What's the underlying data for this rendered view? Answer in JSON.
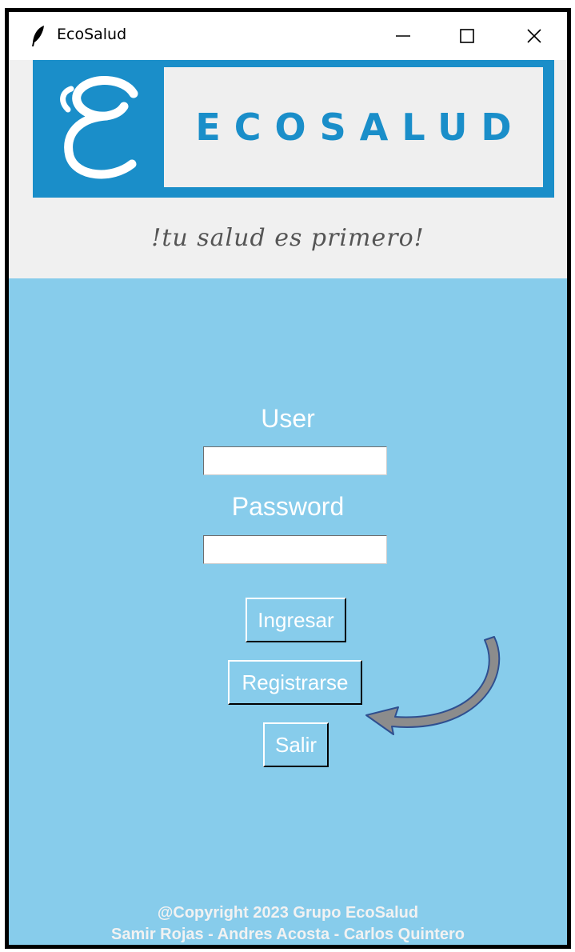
{
  "window": {
    "title": "EcoSalud",
    "controls": [
      "minimize",
      "maximize",
      "close"
    ]
  },
  "header": {
    "logo_text": "ECOSALUD",
    "slogan": "!tu salud es primero!",
    "brand_color": "#1a8ec9"
  },
  "form": {
    "user_label": "User",
    "user_value": "",
    "password_label": "Password",
    "password_value": ""
  },
  "buttons": {
    "login": "Ingresar",
    "register": "Registrarse",
    "exit": "Salir"
  },
  "annotation": {
    "arrow_icon": "curved-arrow-icon",
    "arrow_color": "#8c8c8c"
  },
  "footer": {
    "copyright": "@Copyright 2023 Grupo EcoSalud",
    "authors": "Samir Rojas - Andres Acosta - Carlos Quintero"
  },
  "colors": {
    "background": "#87cceb",
    "header_bg": "#f0f0f0",
    "text": "#ffffff"
  }
}
